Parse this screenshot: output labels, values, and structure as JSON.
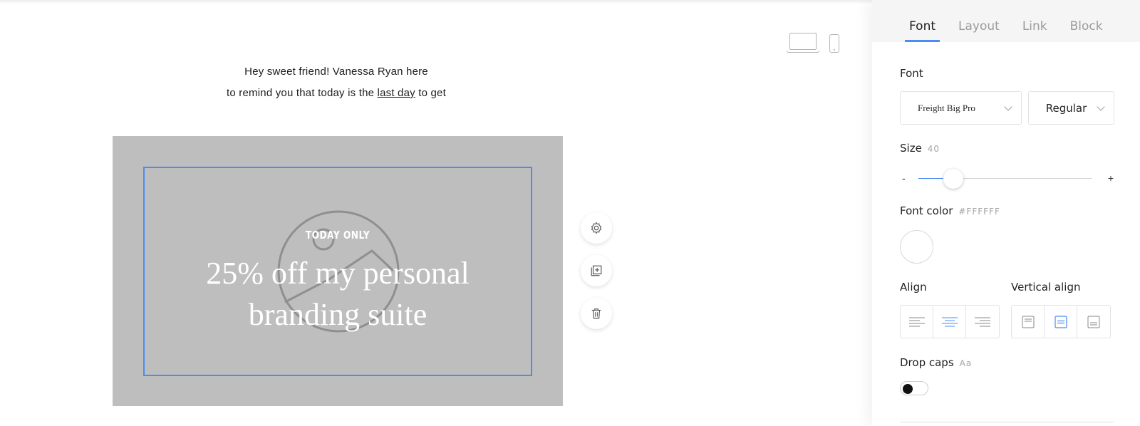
{
  "canvas": {
    "device_toggle": {
      "desktop_icon": "laptop-icon",
      "mobile_icon": "phone-icon"
    },
    "intro": {
      "line1": "Hey sweet friend! Vanessa Ryan here",
      "line2_before": "to remind you that today is the ",
      "line2_link": "last day",
      "line2_after": " to get"
    },
    "hero": {
      "eyebrow": "TODAY ONLY",
      "headline_line1": "25% off my personal",
      "headline_line2": "branding suite",
      "background_color": "#BEBEBE",
      "selection_color": "#4A8CF0"
    },
    "floating_tools": [
      {
        "icon": "gear-icon"
      },
      {
        "icon": "duplicate-icon"
      },
      {
        "icon": "trash-icon"
      }
    ]
  },
  "panel": {
    "tabs": [
      {
        "label": "Font",
        "active": true
      },
      {
        "label": "Layout",
        "active": false
      },
      {
        "label": "Link",
        "active": false
      },
      {
        "label": "Block",
        "active": false
      }
    ],
    "font": {
      "label": "Font",
      "family": "Freight Big Pro",
      "weight": "Regular"
    },
    "size": {
      "label": "Size",
      "value": "40",
      "minus": "-",
      "plus": "+",
      "slider_fraction": 0.2
    },
    "font_color": {
      "label": "Font color",
      "value": "#FFFFFF"
    },
    "align": {
      "label": "Align",
      "options": [
        "align-left-icon",
        "align-center-icon",
        "align-right-icon"
      ],
      "selected": "align-center-icon"
    },
    "vertical_align": {
      "label": "Vertical align",
      "options": [
        "valign-top-icon",
        "valign-middle-icon",
        "valign-bottom-icon"
      ],
      "selected": "valign-middle-icon"
    },
    "drop_caps": {
      "label": "Drop caps",
      "sample": "Aa",
      "enabled": false
    },
    "accent_color": "#4A8CF0"
  }
}
